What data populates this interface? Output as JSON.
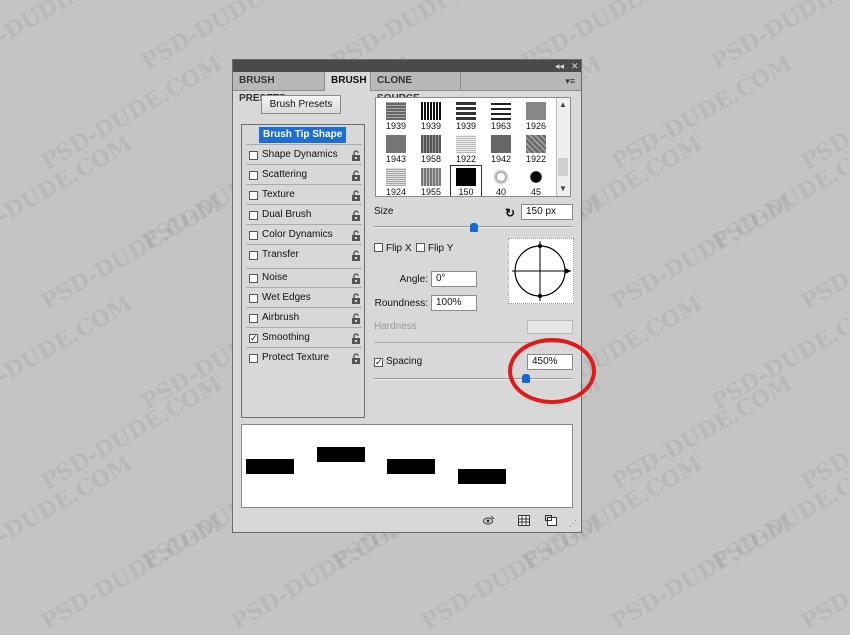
{
  "watermark": "PSD-DUDE.COM",
  "tabs": [
    "BRUSH PRESETS",
    "BRUSH",
    "CLONE SOURCE"
  ],
  "active_tab": "BRUSH",
  "brush_presets_button": "Brush Presets",
  "options": [
    {
      "label": "Brush Tip Shape",
      "checked": null,
      "selected": true,
      "lock": false
    },
    {
      "label": "Shape Dynamics",
      "checked": false,
      "lock": true
    },
    {
      "label": "Scattering",
      "checked": false,
      "lock": true
    },
    {
      "label": "Texture",
      "checked": false,
      "lock": true
    },
    {
      "label": "Dual Brush",
      "checked": false,
      "lock": true
    },
    {
      "label": "Color Dynamics",
      "checked": false,
      "lock": true
    },
    {
      "label": "Transfer",
      "checked": false,
      "lock": true
    },
    {
      "label": "Noise",
      "checked": false,
      "lock": true
    },
    {
      "label": "Wet Edges",
      "checked": false,
      "lock": true
    },
    {
      "label": "Airbrush",
      "checked": false,
      "lock": true
    },
    {
      "label": "Smoothing",
      "checked": true,
      "lock": true
    },
    {
      "label": "Protect Texture",
      "checked": false,
      "lock": true
    }
  ],
  "brush_tips": [
    [
      "1939",
      "1939",
      "1939",
      "1963",
      "1926"
    ],
    [
      "1943",
      "1958",
      "1922",
      "1942",
      "1922"
    ],
    [
      "1924",
      "1955",
      "150",
      "40",
      "45"
    ]
  ],
  "selected_tip": "150",
  "size_label": "Size",
  "size_value": "150 px",
  "size_fraction": 0.5,
  "flip_x_label": "Flip X",
  "flip_y_label": "Flip Y",
  "angle_label": "Angle:",
  "angle_value": "0°",
  "roundness_label": "Roundness:",
  "roundness_value": "100%",
  "hardness_label": "Hardness",
  "spacing_label": "Spacing",
  "spacing_checked": true,
  "spacing_value": "450%",
  "spacing_fraction": 0.45,
  "colors": {
    "selection": "#1e6fd1",
    "slider": "#1569d6",
    "highlight_ring": "#e11b1b"
  }
}
